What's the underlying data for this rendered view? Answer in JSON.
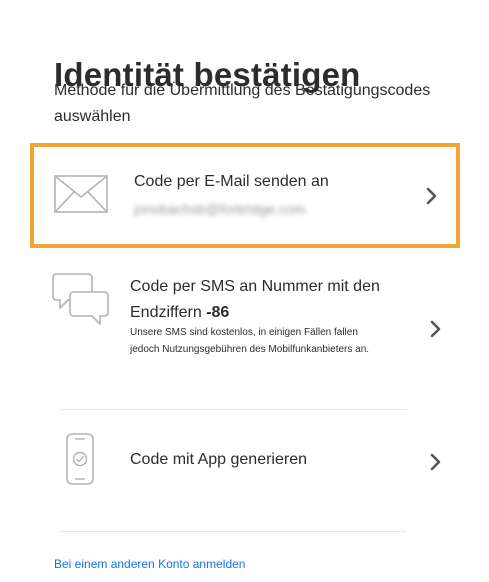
{
  "page": {
    "title": "Identität bestätigen",
    "subtitle": "Methode für die Übermittlung des Bestätigungscodes auswählen"
  },
  "options": {
    "email": {
      "label": "Code per E-Mail senden an",
      "address": "jonobachsb@forbridge.com",
      "icon": "envelope-icon",
      "selected": true
    },
    "sms": {
      "label": "Code per SMS an Nummer mit den Endziffern ",
      "suffix": "-86",
      "note": "Unsere SMS sind kostenlos, in einigen Fällen fallen jedoch Nutzungsgebühren des Mobilfunkanbieters an.",
      "icon": "chat-bubbles-icon"
    },
    "app": {
      "label": "Code mit App generieren",
      "icon": "phone-check-icon"
    }
  },
  "footer": {
    "link": "Bei einem anderen Konto anmelden"
  },
  "colors": {
    "accent_border": "#f4a531",
    "link": "#1473e6",
    "text": "#2c2c2c",
    "icon": "#b3b3b3"
  }
}
